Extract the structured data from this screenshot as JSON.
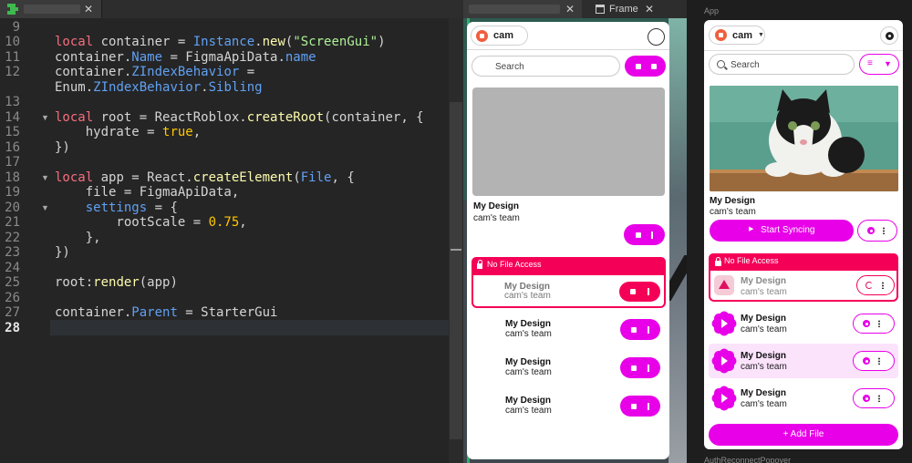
{
  "editor": {
    "line_numbers": [
      "9",
      "10",
      "11",
      "12",
      "",
      "13",
      "14",
      "15",
      "16",
      "17",
      "18",
      "19",
      "20",
      "21",
      "22",
      "23",
      "24",
      "25",
      "26",
      "27",
      "28"
    ],
    "current_line": "28",
    "code": {
      "l10_kw": "local",
      "l10_a": " container = ",
      "l10_b": "Instance",
      "l10_c": ".",
      "l10_d": "new",
      "l10_e": "(",
      "l10_f": "\"ScreenGui\"",
      "l10_g": ")",
      "l11_a": "container.",
      "l11_b": "Name",
      "l11_c": " = FigmaApiData.",
      "l11_d": "name",
      "l12_a": "container.",
      "l12_b": "ZIndexBehavior",
      "l12_c": " =",
      "l12w_a": "Enum.",
      "l12w_b": "ZIndexBehavior",
      "l12w_c": ".",
      "l12w_d": "Sibling",
      "l14_kw": "local",
      "l14_a": " root = ReactRoblox.",
      "l14_b": "createRoot",
      "l14_c": "(container, {",
      "l15_a": "    hydrate = ",
      "l15_b": "true",
      "l15_c": ",",
      "l16": "})",
      "l18_kw": "local",
      "l18_a": " app = React.",
      "l18_b": "createElement",
      "l18_c": "(",
      "l18_d": "File",
      "l18_e": ", {",
      "l19": "    file = FigmaApiData,",
      "l20_a": "    ",
      "l20_b": "settings",
      "l20_c": " = {",
      "l21_a": "        rootScale = ",
      "l21_b": "0.75",
      "l21_c": ",",
      "l22": "    },",
      "l23": "})",
      "l25_a": "root:",
      "l25_b": "render",
      "l25_c": "(app)",
      "l27_a": "container.",
      "l27_b": "Parent",
      "l27_c": " = StarterGui"
    }
  },
  "viewport": {
    "tab2_label": "Frame",
    "close_glyph": "✕"
  },
  "left_panel": {
    "account": "cam",
    "search_placeholder": "Search",
    "featured": {
      "name": "My Design",
      "team": "cam's team"
    },
    "no_access_label": "No File Access",
    "error_item": {
      "name": "My Design",
      "team": "cam's team"
    },
    "items": [
      {
        "name": "My Design",
        "team": "cam's team"
      },
      {
        "name": "My Design",
        "team": "cam's team"
      },
      {
        "name": "My Design",
        "team": "cam's team"
      }
    ]
  },
  "right_panel": {
    "section_label": "App",
    "account": "cam",
    "search_placeholder": "Search",
    "featured": {
      "name": "My Design",
      "team": "cam's team"
    },
    "start_syncing_label": "Start Syncing",
    "no_access_label": "No File Access",
    "error_item": {
      "name": "My Design",
      "team": "cam's team"
    },
    "items": [
      {
        "name": "My Design",
        "team": "cam's team"
      },
      {
        "name": "My Design",
        "team": "cam's team"
      },
      {
        "name": "My Design",
        "team": "cam's team"
      }
    ],
    "add_file_label": "+ Add File",
    "bottom_label": "AuthReconnectPopover"
  },
  "colors": {
    "accent": "#e800e8",
    "danger": "#f50057",
    "editor_bg": "#252526"
  }
}
